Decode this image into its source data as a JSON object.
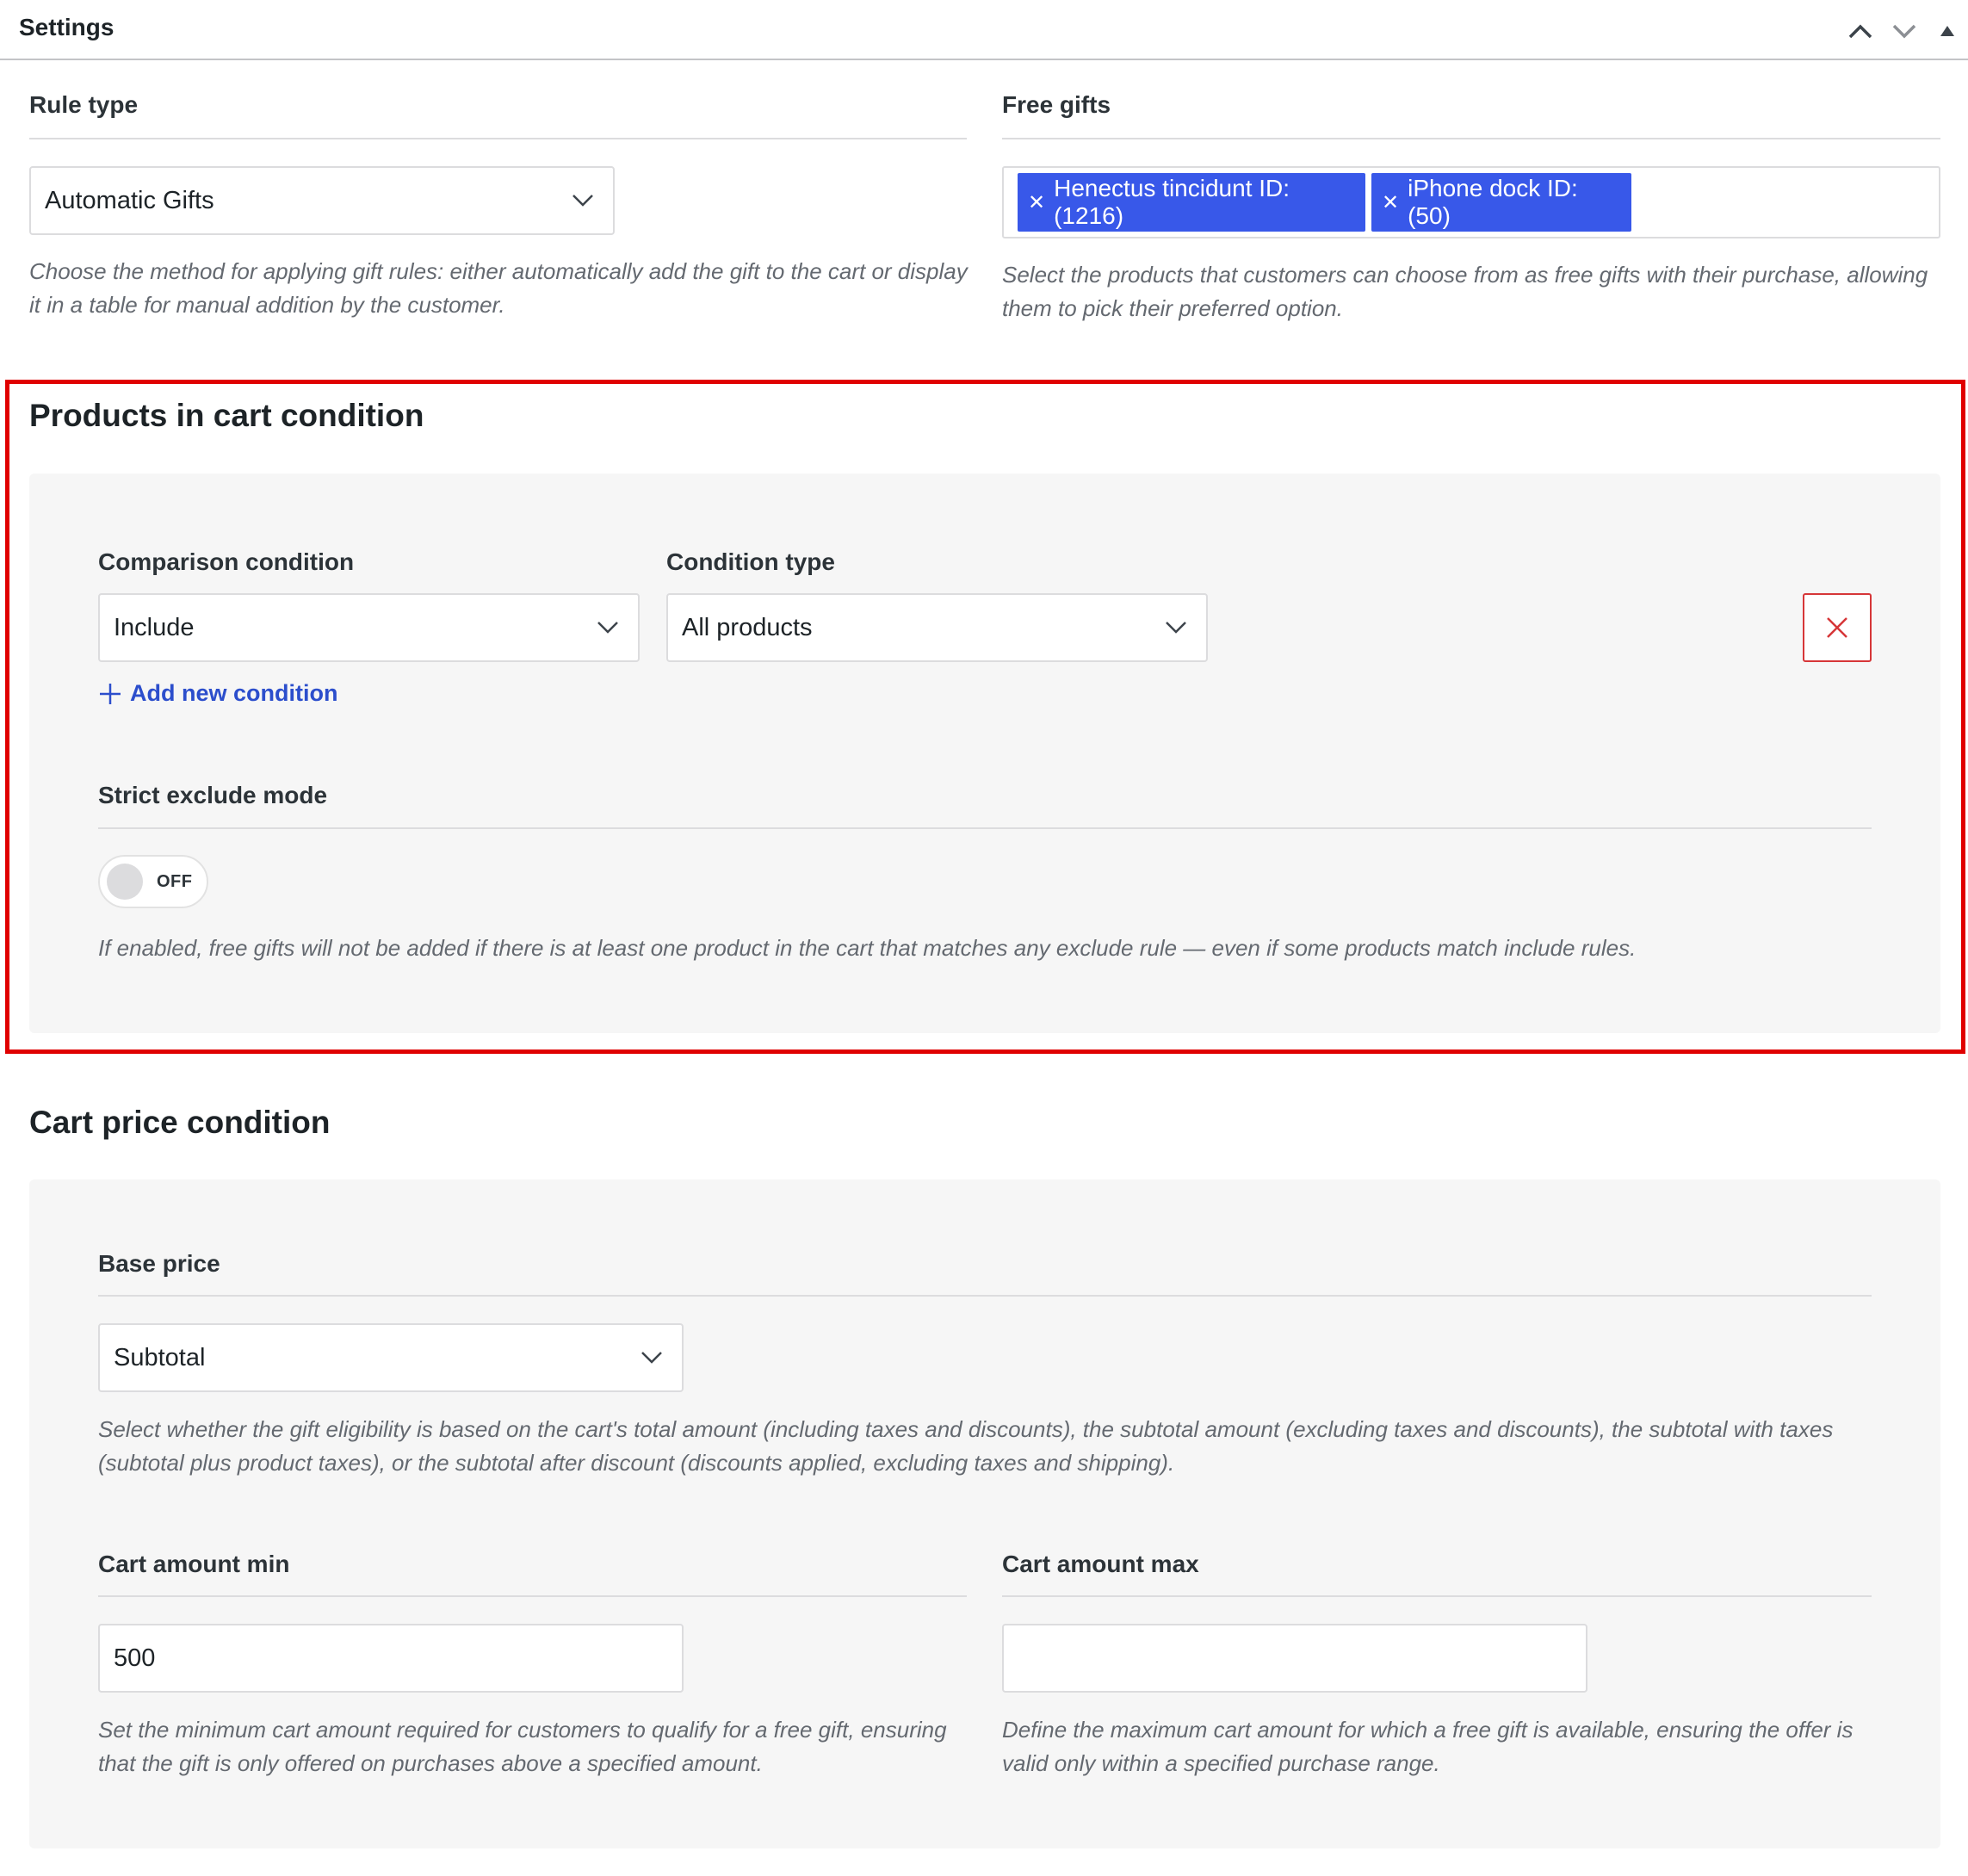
{
  "header": {
    "title": "Settings"
  },
  "rule_type": {
    "label": "Rule type",
    "selected": "Automatic Gifts",
    "help": "Choose the method for applying gift rules: either automatically add the gift to the cart or display it in a table for manual addition by the customer."
  },
  "free_gifts": {
    "label": "Free gifts",
    "chips": [
      "Henectus tincidunt ID:(1216)",
      "iPhone dock ID:(50)"
    ],
    "help": "Select the products that customers can choose from as free gifts with their purchase, allowing them to pick their preferred option."
  },
  "products_condition": {
    "title": "Products in cart condition",
    "comparison_label": "Comparison condition",
    "comparison_selected": "Include",
    "type_label": "Condition type",
    "type_selected": "All products",
    "add_label": "Add new condition",
    "strict_label": "Strict exclude mode",
    "toggle_text": "OFF",
    "strict_help": "If enabled, free gifts will not be added if there is at least one product in the cart that matches any exclude rule — even if some products match include rules."
  },
  "cart_price": {
    "title": "Cart price condition",
    "base_label": "Base price",
    "base_selected": "Subtotal",
    "base_help": "Select whether the gift eligibility is based on the cart's total amount (including taxes and discounts), the subtotal amount (excluding taxes and discounts), the subtotal with taxes (subtotal plus product taxes), or the subtotal after discount (discounts applied, excluding taxes and shipping).",
    "min_label": "Cart amount min",
    "min_value": "500",
    "min_help": "Set the minimum cart amount required for customers to qualify for a free gift, ensuring that the gift is only offered on purchases above a specified amount.",
    "max_label": "Cart amount max",
    "max_value": "",
    "max_help": "Define the maximum cart amount for which a free gift is available, ensuring the offer is valid only within a specified purchase range."
  },
  "colors": {
    "chip": "#3858e9",
    "highlight": "#e00000",
    "remove": "#d63638",
    "link": "#2c4ecc"
  }
}
